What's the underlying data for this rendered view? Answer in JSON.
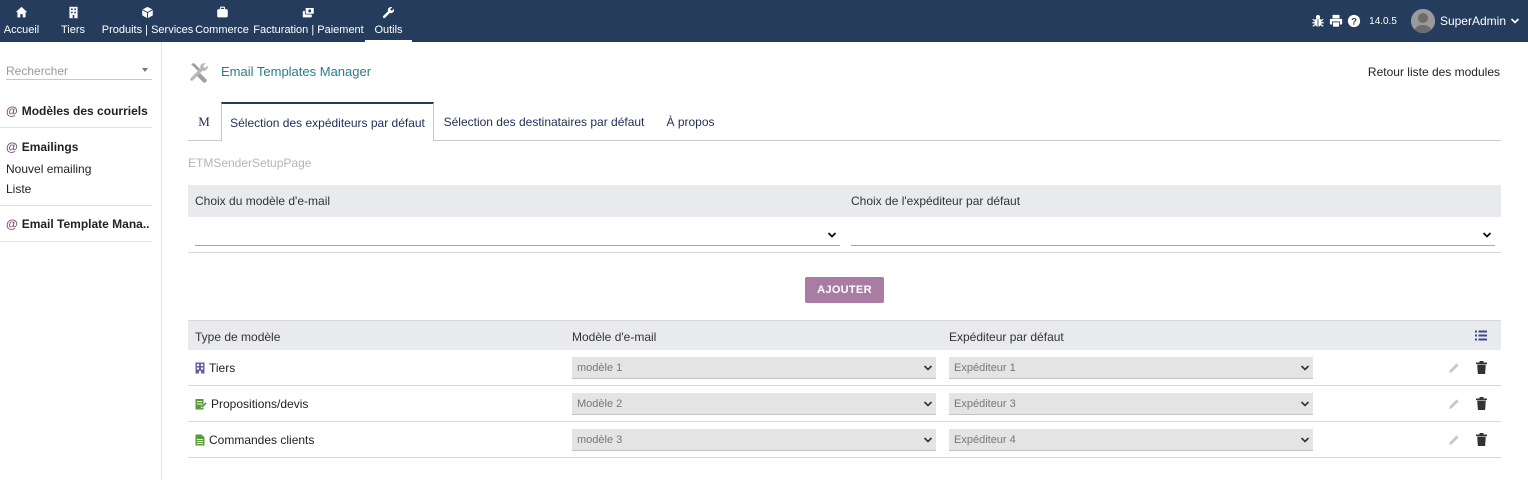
{
  "topnav": {
    "items": [
      {
        "label": "Accueil",
        "icon": "home-icon"
      },
      {
        "label": "Tiers",
        "icon": "building-icon"
      },
      {
        "label": "Produits | Services",
        "icon": "cube-icon"
      },
      {
        "label": "Commerce",
        "icon": "briefcase-icon"
      },
      {
        "label": "Facturation | Paiement",
        "icon": "money-icon"
      },
      {
        "label": "Outils",
        "icon": "wrench-icon"
      }
    ],
    "version": "14.0.5",
    "username": "SuperAdmin"
  },
  "sidebar": {
    "search_placeholder": "Rechercher",
    "at": "@",
    "section1_title": "Modèles des courriels",
    "section2_title": "Emailings",
    "section2_links": [
      "Nouvel emailing",
      "Liste"
    ],
    "section3_title": "Email Template Mana..."
  },
  "main": {
    "title": "Email Templates Manager",
    "back_link": "Retour liste des modules",
    "tabs": [
      "M",
      "Sélection des expéditeurs par défaut",
      "Sélection des destinataires par défaut",
      "À propos"
    ],
    "setup_page": "ETMSenderSetupPage",
    "form": {
      "col1": "Choix du modèle d'e-mail",
      "col2": "Choix de l'expéditeur par défaut"
    },
    "add_button": "AJOUTER",
    "list": {
      "headers": [
        "Type de modèle",
        "Modèle d'e-mail",
        "Expéditeur par défaut"
      ],
      "rows": [
        {
          "type": "Tiers",
          "icon": "building-icon",
          "model": "modèle 1",
          "sender": "Expéditeur 1"
        },
        {
          "type": "Propositions/devis",
          "icon": "proposal-icon",
          "model": "Modèle 2",
          "sender": "Expéditeur 3"
        },
        {
          "type": "Commandes clients",
          "icon": "order-icon",
          "model": "modèle 3",
          "sender": "Expéditeur 4"
        }
      ]
    }
  },
  "colors": {
    "topbar": "#263c5c",
    "accent_button": "#a97ca3",
    "title": "#2a7c8a",
    "table_header": "#e9eaed"
  }
}
